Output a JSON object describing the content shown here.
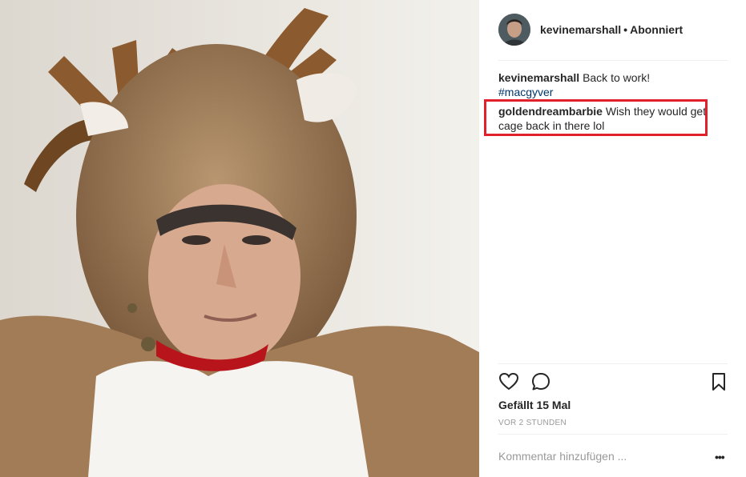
{
  "post": {
    "username": "kevinemarshall",
    "follow_status": "Abonniert",
    "separator": "•"
  },
  "comments": [
    {
      "user": "kevinemarshall",
      "text": "Back to work!",
      "hashtag": "#macgyver"
    },
    {
      "user": "goldendreambarbie",
      "text": "Wish they would get cage back in there lol"
    }
  ],
  "actions": {
    "like_icon": "heart-icon",
    "comment_icon": "comment-bubble-icon",
    "save_icon": "bookmark-icon"
  },
  "likes_text": "Gefällt 15 Mal",
  "timestamp": "VOR 2 STUNDEN",
  "comment_placeholder": "Kommentar hinzufügen ...",
  "more_label": "•••",
  "colors": {
    "highlight_border": "#e0202b",
    "hashtag": "#003569",
    "muted": "#999999"
  }
}
